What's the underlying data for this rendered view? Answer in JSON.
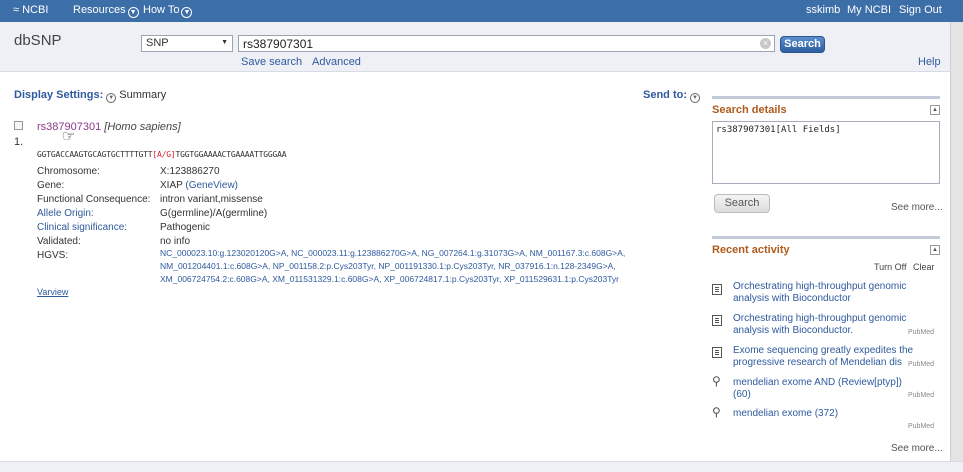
{
  "topbar": {
    "logo": "NCBI",
    "resources": "Resources",
    "howto": "How To",
    "user": "sskimb",
    "myncbi": "My NCBI",
    "signout": "Sign Out"
  },
  "searchbar": {
    "db_title": "dbSNP",
    "db_selected": "SNP",
    "term": "rs387907301",
    "search_label": "Search",
    "save_search": "Save search",
    "advanced": "Advanced",
    "help": "Help"
  },
  "display": {
    "settings_label": "Display Settings:",
    "summary": "Summary",
    "send_to": "Send to:"
  },
  "result": {
    "number": "1.",
    "rsid": "rs387907301",
    "species": "[Homo sapiens]",
    "seq_left": "GGTGACCAAGTGCAGTGCTTTTGTT",
    "seq_variant": "[A/G]",
    "seq_right": "TGGTGGAAAACTGAAAATTGGGAA",
    "fields": {
      "chromosome_label": "Chromosome:",
      "chromosome": "X:123886270",
      "gene_label": "Gene:",
      "gene": "XIAP",
      "gene_view": "(GeneView)",
      "consequence_label": "Functional Consequence:",
      "consequence": "intron variant,missense",
      "allele_label": "Allele Origin:",
      "allele": "G(germline)/A(germline)",
      "clinical_label": "Clinical significance:",
      "clinical": "Pathogenic",
      "validated_label": "Validated:",
      "validated": "no info",
      "hgvs_label": "HGVS:",
      "hgvs_line1": "NC_000023.10:g.123020120G>A, NC_000023.11:g.123886270G>A, NG_007264.1:g.31073G>A, NM_001167.3:c.608G>A,",
      "hgvs_line2": "NM_001204401.1:c.608G>A, NP_001158.2:p.Cys203Tyr, NP_001191330.1:p.Cys203Tyr, NR_037916.1:n.128-2349G>A,",
      "hgvs_line3": "XM_006724754.2:c.608G>A, XM_011531329.1:c.608G>A, XP_006724817.1:p.Cys203Tyr, XP_011529631.1:p.Cys203Tyr"
    },
    "varview": "Varview"
  },
  "search_details": {
    "header": "Search details",
    "query": "rs387907301[All Fields]",
    "search_label": "Search",
    "see_more": "See more..."
  },
  "recent_activity": {
    "header": "Recent activity",
    "turn_off": "Turn Off",
    "clear": "Clear",
    "items": [
      {
        "icon": "document-icon",
        "text": "Orchestrating high-throughput genomic analysis with Bioconductor",
        "db": ""
      },
      {
        "icon": "document-icon",
        "text": "Orchestrating high-throughput genomic analysis with Bioconductor.",
        "db": "PubMed"
      },
      {
        "icon": "document-icon",
        "text": "Exome sequencing greatly expedites the progressive research of Mendelian dis",
        "db": "PubMed"
      },
      {
        "icon": "search-icon",
        "text": "mendelian exome AND (Review[ptyp]) (60)",
        "db": "PubMed"
      },
      {
        "icon": "search-icon",
        "text": "mendelian exome (372)",
        "db": "PubMed"
      }
    ],
    "see_more": "See more..."
  }
}
